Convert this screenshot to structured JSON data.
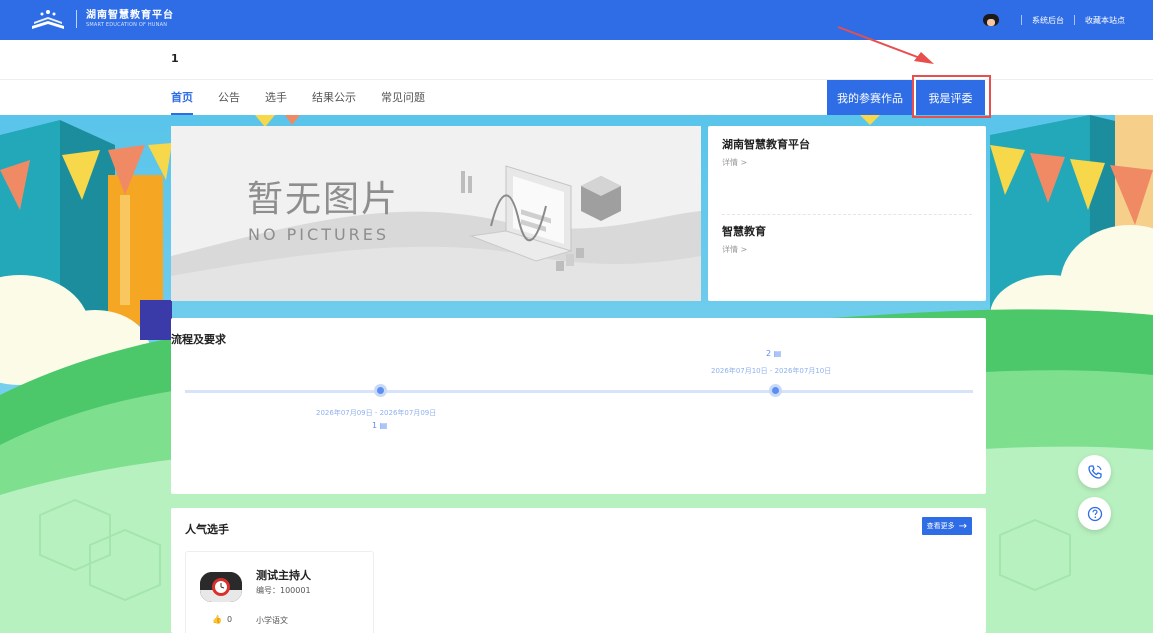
{
  "header": {
    "logo_cn": "湖南智慧教育平台",
    "logo_en": "SMART EDUCATION OF HUNAN",
    "links": [
      "系统后台",
      "收藏本站点"
    ]
  },
  "page": {
    "title": "1"
  },
  "nav": {
    "tabs": [
      "首页",
      "公告",
      "选手",
      "结果公示",
      "常见问题"
    ],
    "active_tab": "首页",
    "my_works_label": "我的参赛作品",
    "judge_label": "我是评委"
  },
  "banner": {
    "text_cn": "暂无图片",
    "text_en": "NO PICTURES"
  },
  "news": [
    {
      "title": "湖南智慧教育平台",
      "detail": "详情 >"
    },
    {
      "title": "智慧教育",
      "detail": "详情 >"
    }
  ],
  "process": {
    "title": "流程及要求",
    "steps": [
      {
        "step": "1 ▤",
        "date": "2026年07月09日 - 2026年07月09日"
      },
      {
        "step": "2 ▤",
        "date": "2026年07月10日 - 2026年07月10日"
      }
    ]
  },
  "popular": {
    "title": "人气选手",
    "more_label": "查看更多",
    "contestants": [
      {
        "name": "测试主持人",
        "id": "编号：100001",
        "likes": "0",
        "subject": "小学语文"
      }
    ]
  },
  "colors": {
    "primary": "#2f6de6",
    "highlight": "#e94e4e"
  },
  "icons": {
    "phone": "phone-icon",
    "help": "help-icon"
  }
}
